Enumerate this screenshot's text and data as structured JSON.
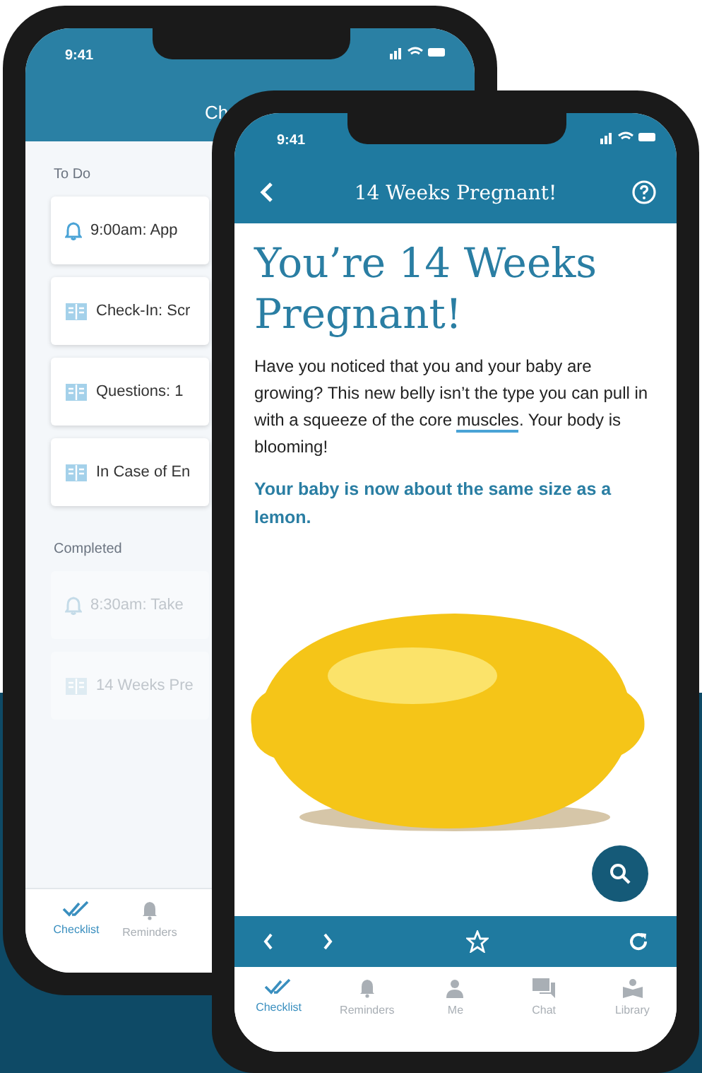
{
  "back_phone": {
    "status_time": "9:41",
    "header_title": "Ch",
    "sections": [
      {
        "heading": "To Do",
        "items": [
          {
            "kind": "reminder",
            "text": "9:00am: App",
            "completed": false
          },
          {
            "kind": "article",
            "text": "Check-In: Scr",
            "completed": false
          },
          {
            "kind": "article",
            "text": "Questions: 1",
            "completed": false
          },
          {
            "kind": "article",
            "text": "In Case of En",
            "completed": false
          }
        ]
      },
      {
        "heading": "Completed",
        "items": [
          {
            "kind": "reminder",
            "text": "8:30am: Take",
            "completed": true
          },
          {
            "kind": "article",
            "text": "14 Weeks Pre",
            "completed": true
          }
        ]
      }
    ],
    "tabs": [
      {
        "label": "Checklist",
        "selected": true
      },
      {
        "label": "Reminders",
        "selected": false
      }
    ]
  },
  "front_phone": {
    "status_time": "9:41",
    "nav_title": "14 Weeks Pregnant!",
    "heading": "You’re 14 Weeks Pregnant!",
    "body": [
      {
        "text": "Have you noticed that you and your baby are growing? This new belly isn’t the type you can pull in with a squeeze of the core ",
        "link": false
      },
      {
        "text": "muscles",
        "link": true
      },
      {
        "text": ". Your body is blooming!",
        "link": false
      }
    ],
    "highlight": "Your baby is now about the same size as a lemon.",
    "tabs": [
      {
        "label": "Checklist",
        "selected": true
      },
      {
        "label": "Reminders",
        "selected": false
      },
      {
        "label": "Me",
        "selected": false
      },
      {
        "label": "Chat",
        "selected": false
      },
      {
        "label": "Library",
        "selected": false
      }
    ]
  }
}
